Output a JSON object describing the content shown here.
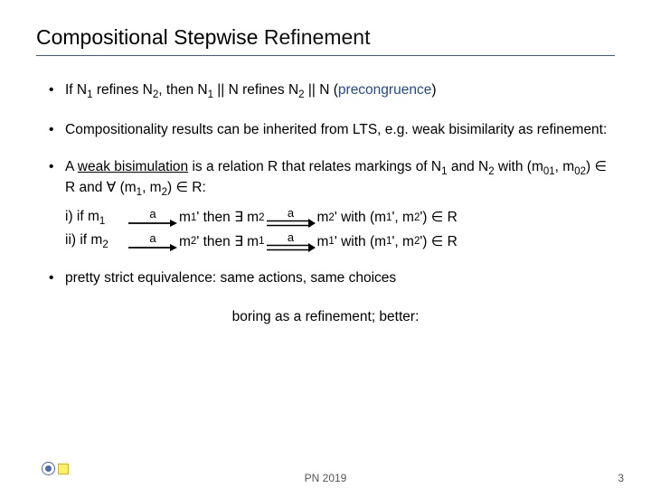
{
  "title_prefix": "Compositional Stepwise ",
  "title_refine": "Refinement",
  "bullet1_parts": {
    "t1": "If N",
    "t2": " refines N",
    "t3": ", then N",
    "t4": " || N refines N",
    "t5": " || N  (",
    "t6": "precongruence",
    "t7": ")"
  },
  "bullet2": "Compositionality results can be inherited from LTS, e.g. weak bisimilarity as refinement:",
  "bullet3_parts": {
    "t1": "A ",
    "t2": "weak bisimulation",
    "t3": " is a relation R that relates markings of N",
    "t4": " and N",
    "t5": " with (m",
    "t6": ", m",
    "t7": ") ∈ R and ∀ (m",
    "t8": ", m",
    "t9": ") ∈ R:"
  },
  "line_i": {
    "lbl": "i)  if m",
    "m1p": "m",
    "then": "'  then ∃ m",
    "m2p": "m",
    "with": "'  with (m",
    "end": "') ∈ R"
  },
  "line_ii": {
    "lbl": "ii)  if m",
    "m2p": "m",
    "then": "'  then ∃ m",
    "m1p": "m",
    "with": "'  with (m",
    "end": "') ∈ R"
  },
  "arrow_label": "a",
  "subs": {
    "s1": "1",
    "s2": "2",
    "s01": "01",
    "s02": "02",
    "s1p": "1",
    "s2p": "2"
  },
  "bullet4": "pretty strict equivalence: same actions, same choices",
  "boring": "boring as a refinement;  better:",
  "footer_center": "PN 2019",
  "footer_right": "3"
}
